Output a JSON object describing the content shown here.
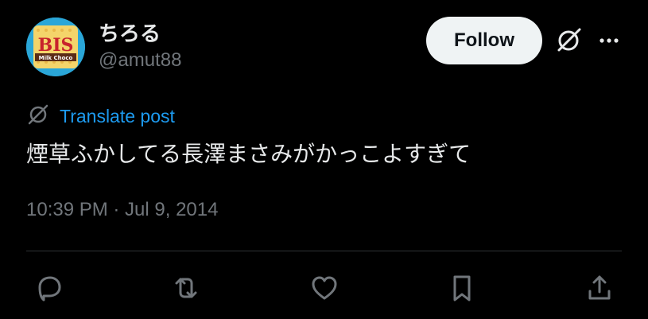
{
  "author": {
    "display_name": "ちろる",
    "handle": "@amut88",
    "avatar_text": {
      "line1": "BIS",
      "line2": "Milk Choco"
    }
  },
  "actions": {
    "follow_label": "Follow",
    "grok_icon": "grok-icon",
    "more_icon": "more-icon"
  },
  "translate": {
    "label": "Translate post",
    "icon": "globe-slash-icon"
  },
  "post": {
    "text": "煙草ふかしてる長澤まさみがかっこよすぎて",
    "timestamp": "10:39 PM · Jul 9, 2014"
  },
  "engagement_bar": {
    "icons": [
      "reply-icon",
      "repost-icon",
      "like-icon",
      "bookmark-icon",
      "share-icon"
    ]
  },
  "colors": {
    "background": "#000000",
    "text": "#e7e9ea",
    "muted": "#71767b",
    "link": "#1d9bf0",
    "follow_bg": "#eff3f4",
    "divider": "#2f3336"
  }
}
